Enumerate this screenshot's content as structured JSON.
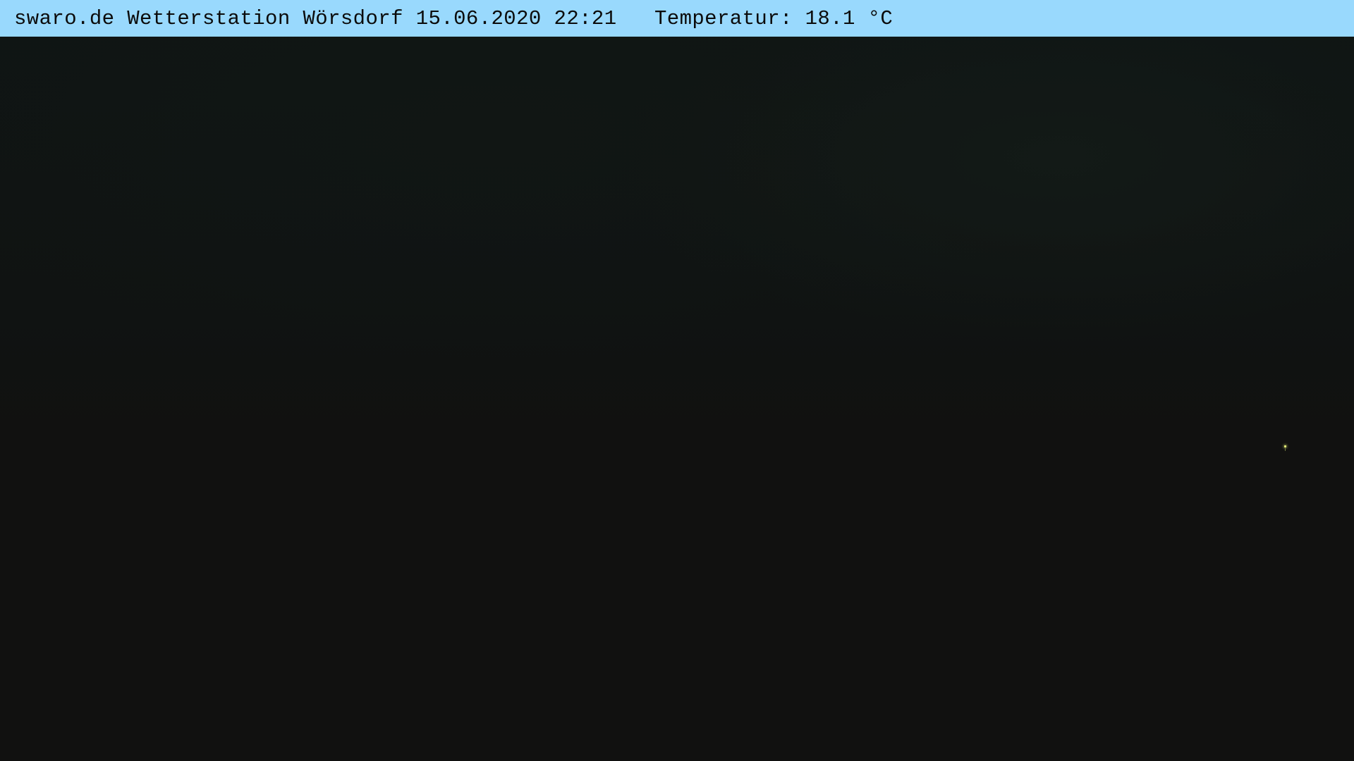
{
  "overlay": {
    "caption": "swaro.de Wetterstation Wörsdorf 15.06.2020 22:21",
    "spacer": "   ",
    "temperature": "Temperatur: 18.1 °C"
  },
  "colors": {
    "overlay_background": "#99d9fd",
    "overlay_text": "#0b0b0b",
    "sky": "#0f1514",
    "ground": "#111110",
    "light": "#e7f07a"
  }
}
